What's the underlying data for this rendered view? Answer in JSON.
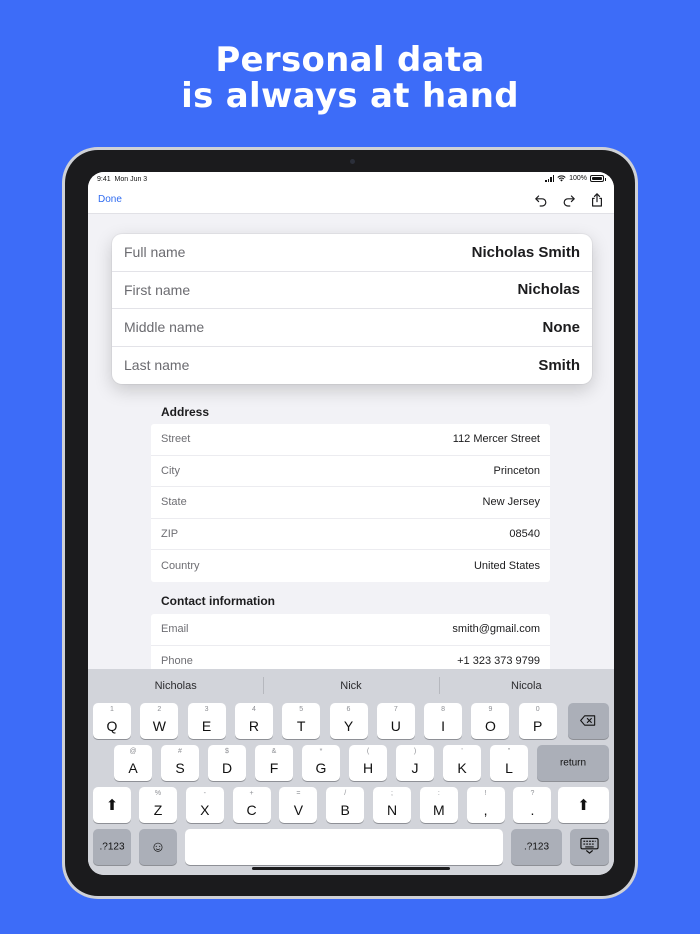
{
  "headline": {
    "line1": "Personal data",
    "line2": "is always at hand"
  },
  "status_bar": {
    "time": "9:41",
    "date": "Mon Jun 3",
    "battery": "100%"
  },
  "navbar": {
    "done_label": "Done",
    "icons": [
      "undo-icon",
      "redo-icon",
      "share-icon"
    ]
  },
  "name_card": {
    "rows": [
      {
        "label": "Full name",
        "value": "Nicholas Smith"
      },
      {
        "label": "First name",
        "value": "Nicholas"
      },
      {
        "label": "Middle name",
        "value": "None"
      },
      {
        "label": "Last name",
        "value": "Smith"
      }
    ]
  },
  "address": {
    "title": "Address",
    "rows": [
      {
        "label": "Street",
        "value": "112 Mercer Street"
      },
      {
        "label": "City",
        "value": "Princeton"
      },
      {
        "label": "State",
        "value": "New Jersey"
      },
      {
        "label": "ZIP",
        "value": "08540"
      },
      {
        "label": "Country",
        "value": "United States"
      }
    ]
  },
  "contact": {
    "title": "Contact information",
    "rows": [
      {
        "label": "Email",
        "value": "smith@gmail.com"
      },
      {
        "label": "Phone",
        "value": "+1 323 373 9799"
      }
    ]
  },
  "keyboard": {
    "predictions": [
      "Nicholas",
      "Nick",
      "Nicola"
    ],
    "row1": [
      {
        "sub": "1",
        "main": "Q"
      },
      {
        "sub": "2",
        "main": "W"
      },
      {
        "sub": "3",
        "main": "E"
      },
      {
        "sub": "4",
        "main": "R"
      },
      {
        "sub": "5",
        "main": "T"
      },
      {
        "sub": "6",
        "main": "Y"
      },
      {
        "sub": "7",
        "main": "U"
      },
      {
        "sub": "8",
        "main": "I"
      },
      {
        "sub": "9",
        "main": "O"
      },
      {
        "sub": "0",
        "main": "P"
      }
    ],
    "row2": [
      {
        "sub": "@",
        "main": "A"
      },
      {
        "sub": "#",
        "main": "S"
      },
      {
        "sub": "$",
        "main": "D"
      },
      {
        "sub": "&",
        "main": "F"
      },
      {
        "sub": "*",
        "main": "G"
      },
      {
        "sub": "(",
        "main": "H"
      },
      {
        "sub": ")",
        "main": "J"
      },
      {
        "sub": "'",
        "main": "K"
      },
      {
        "sub": "\"",
        "main": "L"
      }
    ],
    "row3": [
      {
        "sub": "%",
        "main": "Z"
      },
      {
        "sub": "-",
        "main": "X"
      },
      {
        "sub": "+",
        "main": "C"
      },
      {
        "sub": "=",
        "main": "V"
      },
      {
        "sub": "/",
        "main": "B"
      },
      {
        "sub": ";",
        "main": "N"
      },
      {
        "sub": ":",
        "main": "M"
      },
      {
        "sub": "!",
        "main": ","
      },
      {
        "sub": "?",
        "main": "."
      }
    ],
    "return_label": "return",
    "numbers_label": ".?123"
  },
  "colors": {
    "background": "#3d6cf8",
    "accent": "#2f6bf0"
  }
}
